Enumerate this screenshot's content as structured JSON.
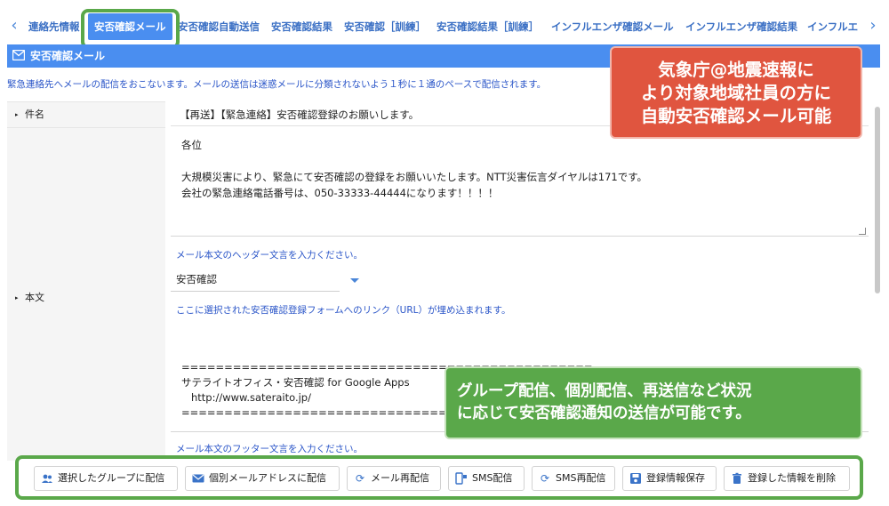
{
  "tabs": {
    "prev_label": "‹",
    "next_label": "›",
    "items": [
      {
        "label": "連絡先情報"
      },
      {
        "label": "安否確認メール"
      },
      {
        "label": "安否確認自動送信"
      },
      {
        "label": "安否確認結果"
      },
      {
        "label": "安否確認［訓練］"
      },
      {
        "label": "安否確認結果［訓練］"
      },
      {
        "label": "インフルエンザ確認メール"
      },
      {
        "label": "インフルエンザ確認結果"
      },
      {
        "label": "インフルエ"
      }
    ]
  },
  "section": {
    "title": "安否確認メール",
    "notice": "緊急連絡先へメールの配信をおこないます。メールの送信は迷惑メールに分類されないよう１秒に１通のペースで配信されます。"
  },
  "form": {
    "subject_label": "件名",
    "subject_value": "【再送】【緊急連絡】安否確認登録のお願いします。",
    "body_label": "本文",
    "body_value": "各位\n\n大規模災害により、緊急にて安否確認の登録をお願いいたします。NTT災害伝言ダイヤルは171です。\n会社の緊急連絡電話番号は、050-33333-44444になります！！！！",
    "header_hint": "メール本文のヘッダー文言を入力ください。",
    "form_select_value": "安否確認",
    "link_hint": "ここに選択された安否確認登録フォームへのリンク（URL）が埋め込まれます。",
    "footer_value": "\n================================================\nサテライトオフィス・安否確認 for Google Apps\n   http://www.sateraito.jp/\n================================",
    "footer_hint": "メール本文のフッター文言を入力ください。"
  },
  "callouts": {
    "red": "気象庁@地震速報に\nより対象地域社員の方に\n自動安否確認メール可能",
    "green": "グループ配信、個別配信、再送信など状況\nに応じて安否確認通知の送信が可能です。"
  },
  "buttons": [
    {
      "label": "選択したグループに配信",
      "icon": "group-icon"
    },
    {
      "label": "個別メールアドレスに配信",
      "icon": "mail-icon"
    },
    {
      "label": "メール再配信",
      "icon": "refresh-icon"
    },
    {
      "label": "SMS配信",
      "icon": "phone-icon"
    },
    {
      "label": "SMS再配信",
      "icon": "refresh-icon"
    },
    {
      "label": "登録情報保存",
      "icon": "save-icon"
    },
    {
      "label": "登録した情報を削除",
      "icon": "trash-icon"
    }
  ],
  "colors": {
    "accent": "#4a8ef0",
    "link_text": "#2a55c8",
    "callout_red": "#e0553f",
    "callout_green": "#5aa84a"
  }
}
